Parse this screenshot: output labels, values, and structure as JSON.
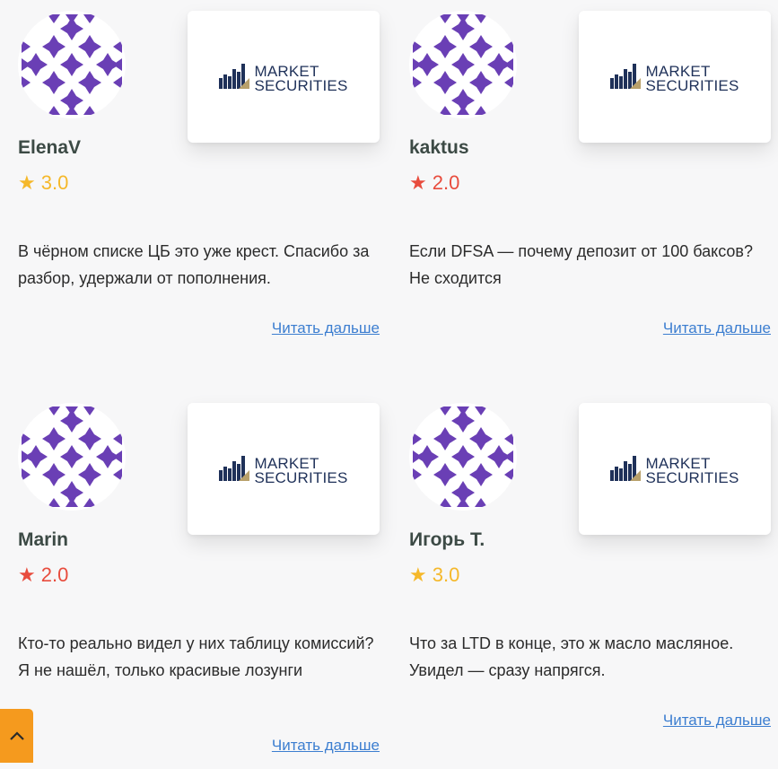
{
  "colors": {
    "gold_star": "#f5b82a",
    "red_star": "#e84c3d",
    "link": "#3c7ed0",
    "accent": "#f59a1e"
  },
  "reviews": [
    {
      "user": "ElenaV",
      "rating": "3.0",
      "star_color": "#f5b82a",
      "text": "В чёрном списке ЦБ это уже крест. Спасибо за разбор, удержали от пополнения.",
      "logo_line1": "MARKET",
      "logo_line2": "SECURITIES",
      "read_more": "Читать дальше"
    },
    {
      "user": "kaktus",
      "rating": "2.0",
      "star_color": "#e84c3d",
      "text": "Если DFSA — почему депозит от 100 баксов? Не сходится",
      "logo_line1": "MARKET",
      "logo_line2": "SECURITIES",
      "read_more": "Читать дальше"
    },
    {
      "user": "Marin",
      "rating": "2.0",
      "star_color": "#e84c3d",
      "text": "Кто-то реально видел у них таблицу комиссий? Я не нашёл, только красивые лозунги",
      "logo_line1": "MARKET",
      "logo_line2": "SECURITIES",
      "read_more": "Читать дальше"
    },
    {
      "user": "Игорь Т.",
      "rating": "3.0",
      "star_color": "#f5b82a",
      "text": "Что за LTD в конце, это ж масло масляное. Увидел — сразу напрягся.",
      "logo_line1": "MARKET",
      "logo_line2": "SECURITIES",
      "read_more": "Читать дальше"
    }
  ],
  "icons": {
    "star": "star-icon",
    "scroll_top": "chevron-up-icon"
  }
}
